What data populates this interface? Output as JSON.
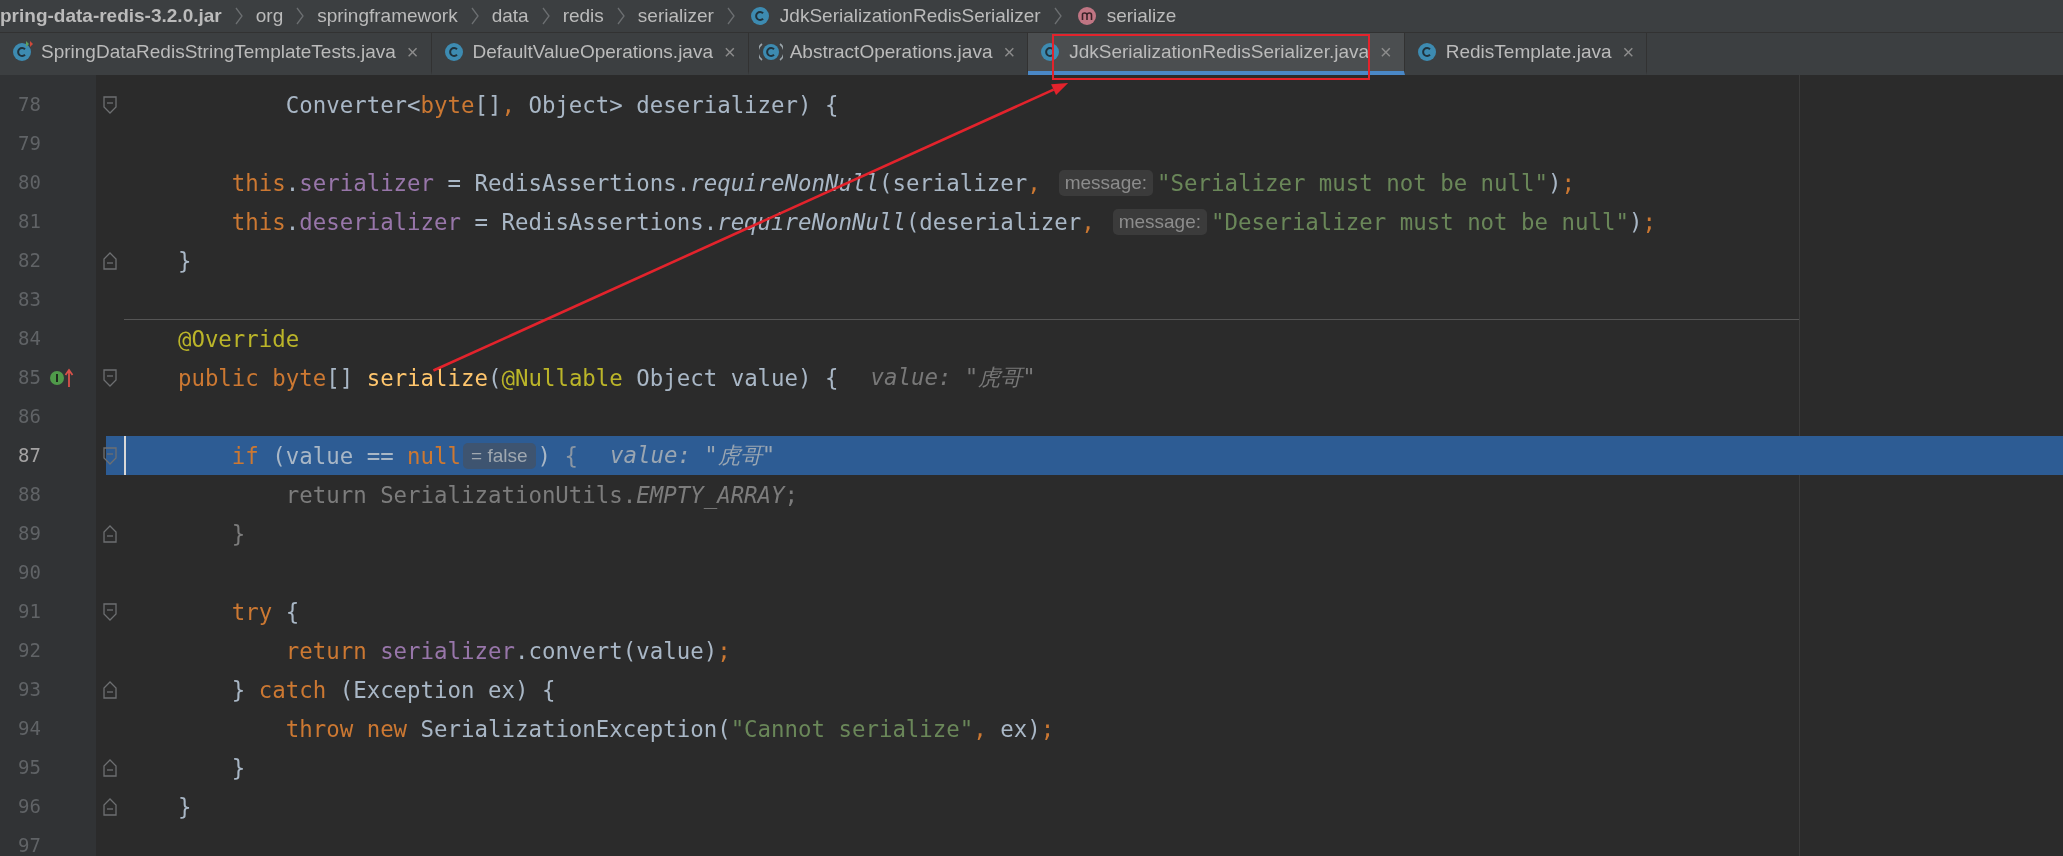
{
  "breadcrumbs": [
    {
      "label": "pring-data-redis-3.2.0.jar",
      "kind": "archive"
    },
    {
      "label": "org",
      "kind": "package"
    },
    {
      "label": "springframework",
      "kind": "package"
    },
    {
      "label": "data",
      "kind": "package"
    },
    {
      "label": "redis",
      "kind": "package"
    },
    {
      "label": "serializer",
      "kind": "package"
    },
    {
      "label": "JdkSerializationRedisSerializer",
      "kind": "class"
    },
    {
      "label": "serialize",
      "kind": "method"
    }
  ],
  "tabs": [
    {
      "label": "SpringDataRedisStringTemplateTests.java",
      "kind": "test-class",
      "close": "×",
      "selected": false,
      "highlighted": false
    },
    {
      "label": "DefaultValueOperations.java",
      "kind": "class",
      "close": "×",
      "selected": false,
      "highlighted": false
    },
    {
      "label": "AbstractOperations.java",
      "kind": "abstract-class",
      "close": "×",
      "selected": false,
      "highlighted": false
    },
    {
      "label": "JdkSerializationRedisSerializer.java",
      "kind": "class",
      "close": "×",
      "selected": true,
      "highlighted": true
    },
    {
      "label": "RedisTemplate.java",
      "kind": "class",
      "close": "×",
      "selected": false,
      "highlighted": false
    }
  ],
  "lines": [
    {
      "number": "78",
      "fold": {
        "kind": "start"
      },
      "selected": false,
      "separator": false,
      "tokens": [
        {
          "kind": "plain",
          "text": "            Converter<"
        },
        {
          "kind": "keyword",
          "text": "byte"
        },
        {
          "kind": "plain",
          "text": "[]"
        },
        {
          "kind": "keyword",
          "text": ","
        },
        {
          "kind": "plain",
          "text": " Object> deserializer) {"
        }
      ]
    },
    {
      "number": "79",
      "selected": false,
      "separator": false
    },
    {
      "number": "80",
      "selected": false,
      "separator": false,
      "tokens": [
        {
          "kind": "keyword",
          "text": "        this"
        },
        {
          "kind": "plain",
          "text": "."
        },
        {
          "kind": "field",
          "text": "serializer"
        },
        {
          "kind": "plain",
          "text": " = RedisAssertions."
        },
        {
          "kind": "italic",
          "text": "requireNonNull"
        },
        {
          "kind": "plain",
          "text": "(serializer"
        },
        {
          "kind": "keyword",
          "text": ","
        },
        {
          "kind": "hint",
          "text": "message:"
        },
        {
          "kind": "string",
          "text": "\"Serializer must not be null\""
        },
        {
          "kind": "plain",
          "text": ")"
        },
        {
          "kind": "keyword",
          "text": ";"
        }
      ]
    },
    {
      "number": "81",
      "selected": false,
      "separator": false,
      "tokens": [
        {
          "kind": "keyword",
          "text": "        this"
        },
        {
          "kind": "plain",
          "text": "."
        },
        {
          "kind": "field",
          "text": "deserializer"
        },
        {
          "kind": "plain",
          "text": " = RedisAssertions."
        },
        {
          "kind": "italic",
          "text": "requireNonNull"
        },
        {
          "kind": "plain",
          "text": "(deserializer"
        },
        {
          "kind": "keyword",
          "text": ","
        },
        {
          "kind": "hint",
          "text": "message:"
        },
        {
          "kind": "string",
          "text": "\"Deserializer must not be null\""
        },
        {
          "kind": "plain",
          "text": ")"
        },
        {
          "kind": "keyword",
          "text": ";"
        }
      ]
    },
    {
      "number": "82",
      "fold": {
        "kind": "end"
      },
      "selected": false,
      "separator": false,
      "tokens": [
        {
          "kind": "plain",
          "text": "    }"
        }
      ]
    },
    {
      "number": "83",
      "selected": false,
      "separator": false
    },
    {
      "number": "84",
      "selected": false,
      "separator": true,
      "tokens": [
        {
          "kind": "annotation",
          "text": "    @Override"
        }
      ]
    },
    {
      "number": "85",
      "fold": {
        "kind": "start"
      },
      "gutter_marker": {
        "kind": "implements-up"
      },
      "selected": false,
      "separator": false,
      "tokens": [
        {
          "kind": "keyword",
          "text": "    public "
        },
        {
          "kind": "keyword",
          "text": "byte"
        },
        {
          "kind": "plain",
          "text": "[] "
        },
        {
          "kind": "declaration",
          "text": "serialize",
          "arrow": true
        },
        {
          "kind": "plain",
          "text": "("
        },
        {
          "kind": "annotation",
          "text": "@Nullable"
        },
        {
          "kind": "plain",
          "text": " Object value) {"
        },
        {
          "kind": "value",
          "text": "value: \"虎哥\""
        }
      ]
    },
    {
      "number": "86",
      "selected": false,
      "separator": false
    },
    {
      "number": "87",
      "fold": {
        "kind": "start"
      },
      "selected": true,
      "separator": false,
      "tokens": [
        {
          "kind": "keyword",
          "text": "        if"
        },
        {
          "kind": "plain",
          "text": " (value == "
        },
        {
          "kind": "keyword",
          "text": "null"
        },
        {
          "kind": "eval",
          "text": "= false"
        },
        {
          "kind": "plain",
          "text": ") "
        },
        {
          "kind": "dim",
          "text": "{"
        },
        {
          "kind": "value",
          "text": "value: \"虎哥\""
        }
      ]
    },
    {
      "number": "88",
      "selected": false,
      "separator": false,
      "tokens": [
        {
          "kind": "dim",
          "text": "            return SerializationUtils."
        },
        {
          "kind": "dim-italic",
          "text": "EMPTY_ARRAY"
        },
        {
          "kind": "dim",
          "text": ";"
        }
      ]
    },
    {
      "number": "89",
      "fold": {
        "kind": "end"
      },
      "selected": false,
      "separator": false,
      "tokens": [
        {
          "kind": "dim",
          "text": "        }"
        }
      ]
    },
    {
      "number": "90",
      "selected": false,
      "separator": false
    },
    {
      "number": "91",
      "fold": {
        "kind": "start"
      },
      "selected": false,
      "separator": false,
      "tokens": [
        {
          "kind": "keyword",
          "text": "        try"
        },
        {
          "kind": "plain",
          "text": " {"
        }
      ]
    },
    {
      "number": "92",
      "selected": false,
      "separator": false,
      "tokens": [
        {
          "kind": "keyword",
          "text": "            return "
        },
        {
          "kind": "field",
          "text": "serializer"
        },
        {
          "kind": "plain",
          "text": ".convert(value)"
        },
        {
          "kind": "keyword",
          "text": ";"
        }
      ]
    },
    {
      "number": "93",
      "fold": {
        "kind": "end"
      },
      "selected": false,
      "separator": false,
      "tokens": [
        {
          "kind": "plain",
          "text": "        } "
        },
        {
          "kind": "keyword",
          "text": "catch"
        },
        {
          "kind": "plain",
          "text": " (Exception ex) {"
        }
      ]
    },
    {
      "number": "94",
      "selected": false,
      "separator": false,
      "tokens": [
        {
          "kind": "keyword",
          "text": "            throw new"
        },
        {
          "kind": "plain",
          "text": " SerializationException("
        },
        {
          "kind": "string",
          "text": "\"Cannot serialize\""
        },
        {
          "kind": "keyword",
          "text": ","
        },
        {
          "kind": "plain",
          "text": " ex)"
        },
        {
          "kind": "keyword",
          "text": ";"
        }
      ]
    },
    {
      "number": "95",
      "fold": {
        "kind": "end"
      },
      "selected": false,
      "separator": false,
      "tokens": [
        {
          "kind": "plain",
          "text": "        }"
        }
      ]
    },
    {
      "number": "96",
      "fold": {
        "kind": "end"
      },
      "selected": false,
      "separator": false,
      "tokens": [
        {
          "kind": "plain",
          "text": "    }"
        }
      ]
    },
    {
      "number": "97",
      "selected": false,
      "separator": false
    }
  ]
}
